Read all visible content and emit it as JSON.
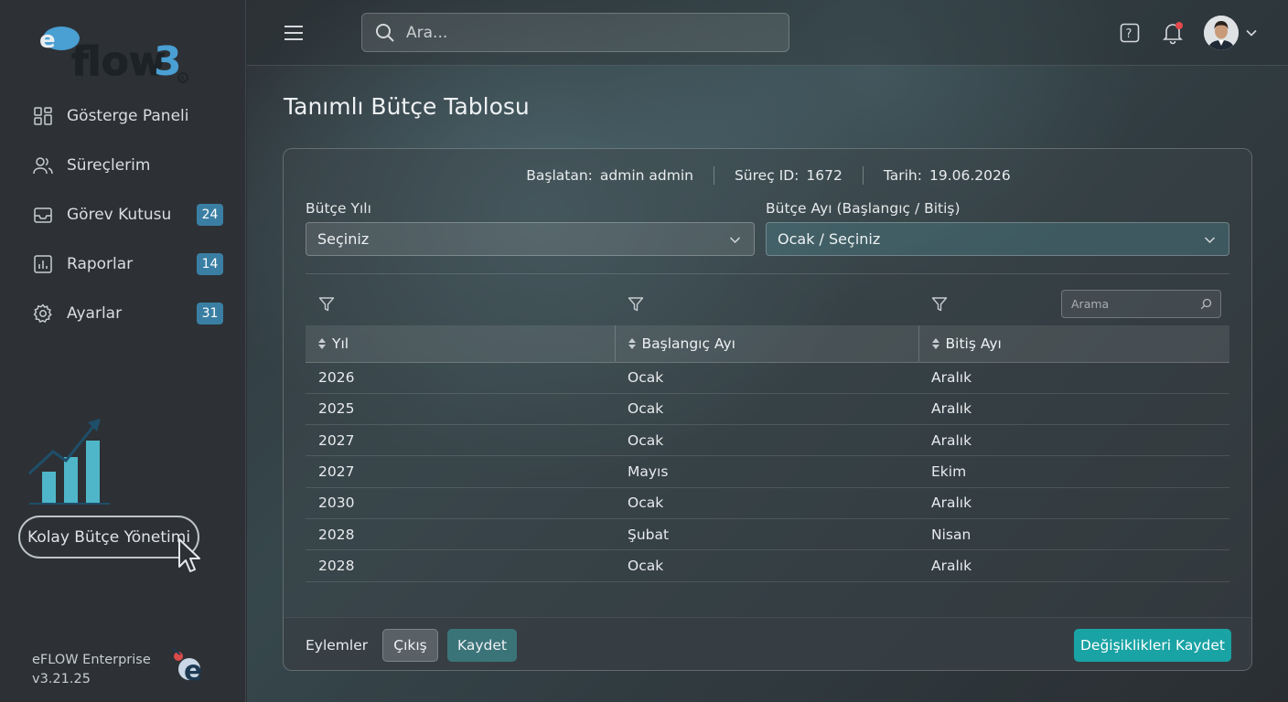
{
  "sidebar": {
    "logo_text": "eflow3",
    "items": [
      {
        "label": "Gösterge Paneli",
        "icon": "dashboard-icon",
        "badge": null
      },
      {
        "label": "Süreçlerim",
        "icon": "users-icon",
        "badge": null
      },
      {
        "label": "Görev Kutusu",
        "icon": "inbox-icon",
        "badge": "24"
      },
      {
        "label": "Raporlar",
        "icon": "report-icon",
        "badge": "14"
      },
      {
        "label": "Ayarlar",
        "icon": "gear-icon",
        "badge": "31"
      }
    ],
    "promo_label": "Kolay Bütçe Yönetimi",
    "product": "eFLOW Enterprise",
    "version": "v3.21.25"
  },
  "topbar": {
    "search_placeholder": "Ara...",
    "notification_dot": true
  },
  "page": {
    "title": "Tanımlı Bütçe Tablosu"
  },
  "meta": {
    "starter_label": "Başlatan:",
    "starter_value": "admin admin",
    "process_label": "Süreç ID:",
    "process_value": "1672",
    "date_label": "Tarih:",
    "date_value": "19.06.2026"
  },
  "form": {
    "year_label": "Bütçe Yılı",
    "year_value": "Seçiniz",
    "month_label": "Bütçe Ayı (Başlangıç / Bitiş)",
    "month_value": "Ocak / Seçiniz"
  },
  "table": {
    "search_placeholder": "Arama",
    "columns": [
      "Yıl",
      "Başlangıç Ayı",
      "Bitiş Ayı"
    ],
    "rows": [
      [
        "2026",
        "Ocak",
        "Aralık"
      ],
      [
        "2025",
        "Ocak",
        "Aralık"
      ],
      [
        "2027",
        "Ocak",
        "Aralık"
      ],
      [
        "2027",
        "Mayıs",
        "Ekim"
      ],
      [
        "2030",
        "Ocak",
        "Aralık"
      ],
      [
        "2028",
        "Şubat",
        "Nisan"
      ],
      [
        "2028",
        "Ocak",
        "Aralık"
      ]
    ]
  },
  "footer": {
    "actions_label": "Eylemler",
    "exit_label": "Çıkış",
    "save_label": "Kaydet",
    "save_changes_label": "Değişiklikleri Kaydet"
  },
  "colors": {
    "accent": "#1aa3a4",
    "badge": "#3a7fa3",
    "logo_blue": "#4a9fd3",
    "notification": "#e5484d"
  }
}
